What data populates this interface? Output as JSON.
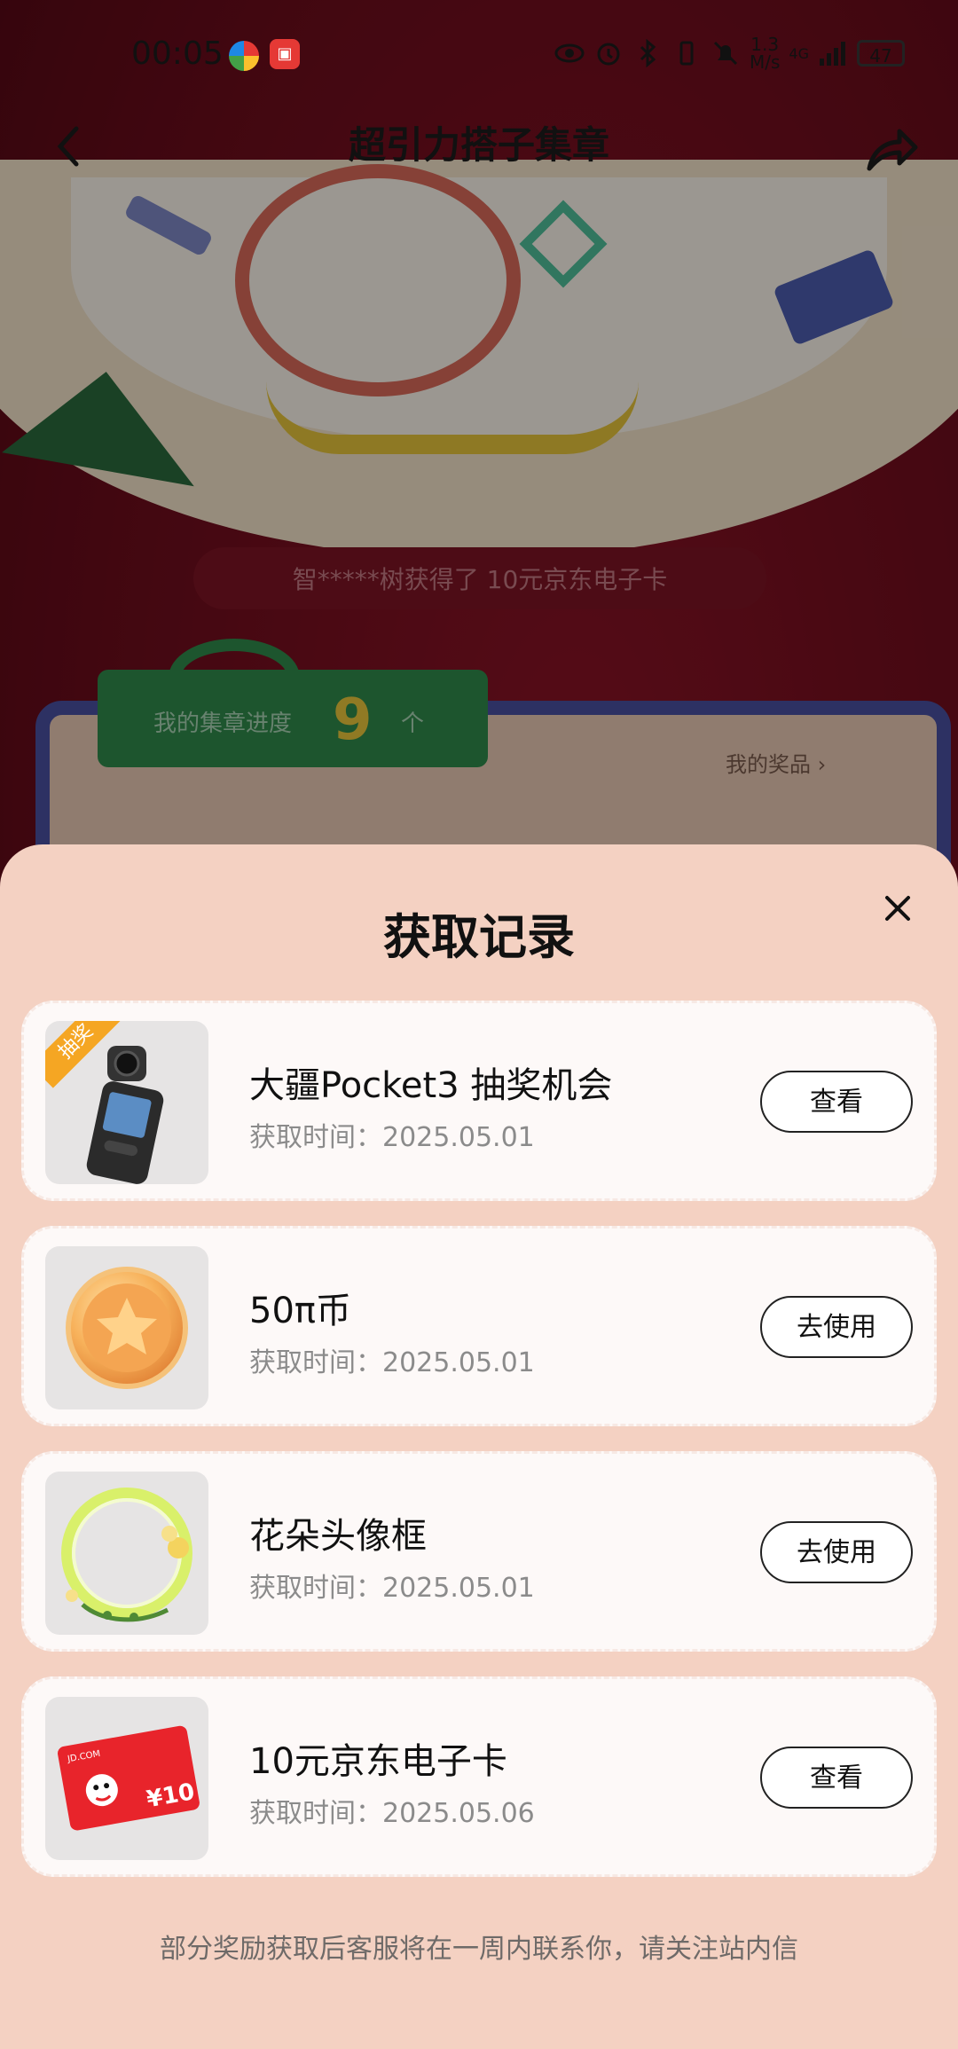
{
  "status_bar": {
    "time": "00:05",
    "speed_value": "1.3",
    "speed_unit": "M/s",
    "network": "4G",
    "battery": "47"
  },
  "nav": {
    "title": "超引力搭子集章"
  },
  "background": {
    "ticker": "智*****树获得了 10元京东电子卡",
    "progress_label": "我的集章进度",
    "progress_count": "9",
    "progress_unit": "个",
    "my_prizes": "我的奖品"
  },
  "sheet": {
    "title": "获取记录",
    "records": [
      {
        "tag": "抽奖",
        "name": "大疆Pocket3 抽奖机会",
        "time": "获取时间：2025.05.01",
        "button": "查看",
        "icon": "camera-icon"
      },
      {
        "name": "50π币",
        "time": "获取时间：2025.05.01",
        "button": "去使用",
        "icon": "coin-icon"
      },
      {
        "name": "花朵头像框",
        "time": "获取时间：2025.05.01",
        "button": "去使用",
        "icon": "avatar-frame-icon"
      },
      {
        "name": "10元京东电子卡",
        "time": "获取时间：2025.05.06",
        "button": "查看",
        "icon": "gift-card-icon",
        "card_brand": "JD.COM",
        "card_value": "¥10"
      }
    ],
    "footer_note": "部分奖励获取后客服将在一周内联系你，请关注站内信"
  },
  "colors": {
    "sheet_bg": "#f4d1c2",
    "card_bg": "#fdf9f8",
    "tag": "#f5a623",
    "background_red": "#6a0c1b"
  }
}
